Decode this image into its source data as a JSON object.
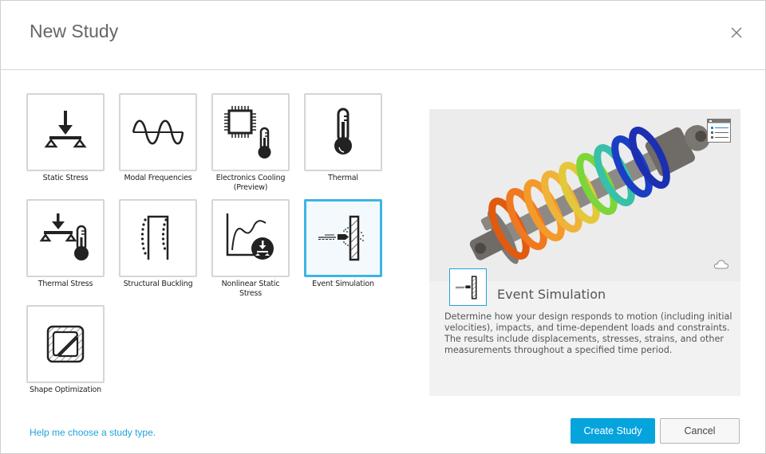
{
  "dialog": {
    "title": "New Study",
    "close_icon": "close-icon"
  },
  "study_types": [
    {
      "label": "Static Stress",
      "icon": "static-stress-icon",
      "selected": false
    },
    {
      "label": "Modal Frequencies",
      "icon": "modal-frequencies-icon",
      "selected": false
    },
    {
      "label": "Electronics Cooling (Preview)",
      "icon": "electronics-cooling-icon",
      "selected": false
    },
    {
      "label": "Thermal",
      "icon": "thermometer-icon",
      "selected": false
    },
    {
      "label": "Thermal Stress",
      "icon": "thermal-stress-icon",
      "selected": false
    },
    {
      "label": "Structural Buckling",
      "icon": "structural-buckling-icon",
      "selected": false
    },
    {
      "label": "Nonlinear Static Stress",
      "icon": "nonlinear-static-stress-icon",
      "selected": false
    },
    {
      "label": "Event Simulation",
      "icon": "event-simulation-icon",
      "selected": true
    },
    {
      "label": "Shape Optimization",
      "icon": "shape-optimization-icon",
      "selected": false
    }
  ],
  "preview": {
    "image": "shock-absorber-spring-simulation-image",
    "legend_icon": "legend-list-icon",
    "cloud_icon": "cloud-icon",
    "title": "Event Simulation",
    "description": "Determine how your design responds to motion (including initial velocities), impacts, and time-dependent loads and constraints. The results include displacements, stresses, strains, and other measurements throughout a specified time period."
  },
  "footer": {
    "help_link": "Help me choose a study type.",
    "create_label": "Create Study",
    "cancel_label": "Cancel"
  },
  "colors": {
    "accent": "#06a4dd",
    "link": "#1ea5d8",
    "selected_border": "#3cb4e5"
  }
}
